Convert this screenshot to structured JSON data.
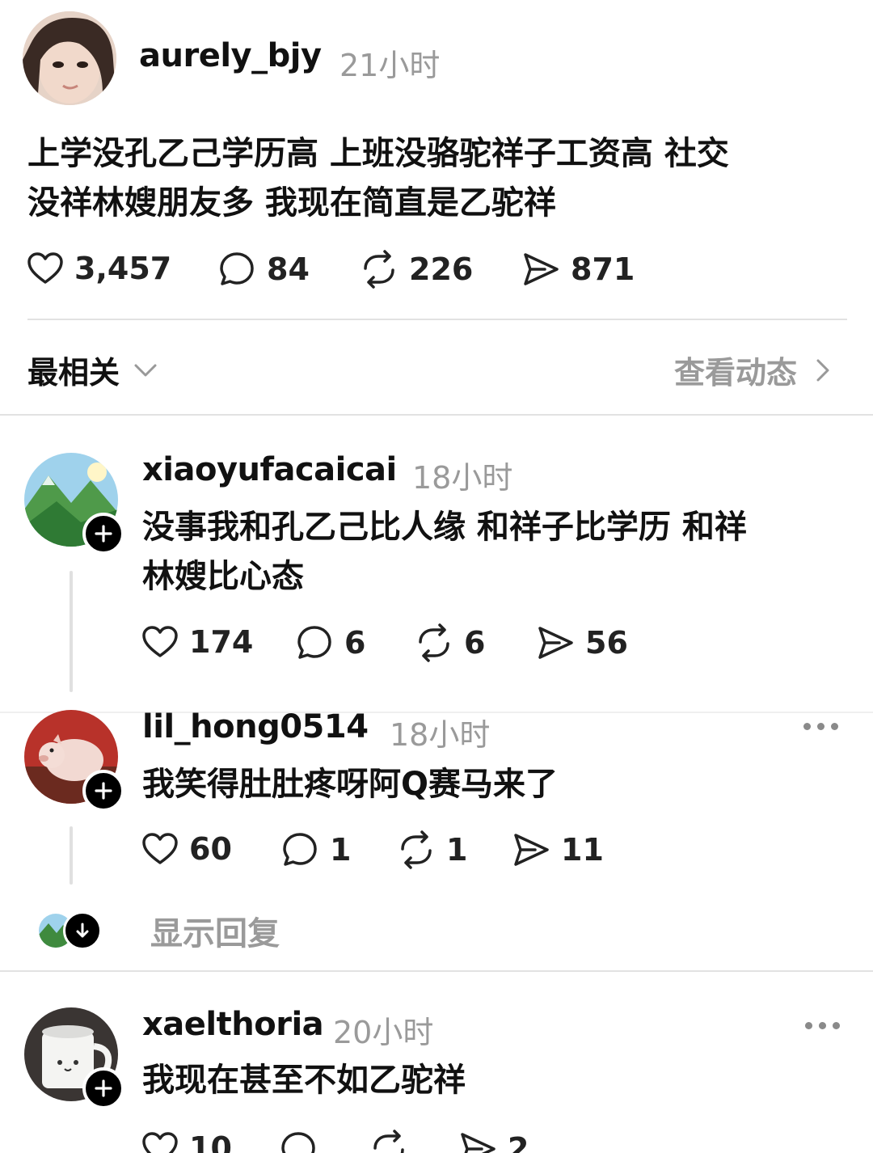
{
  "post": {
    "username": "aurely_bjy",
    "time": "21小时",
    "text_line1": "上学没孔乙己学历高 上班没骆驼祥子工资高 社交",
    "text_line2": "没祥林嫂朋友多 我现在简直是乙驼祥",
    "likes": "3,457",
    "comments": "84",
    "reposts": "226",
    "shares": "871"
  },
  "sort_bar": {
    "label": "最相关",
    "view_activity": "查看动态"
  },
  "replies": [
    {
      "username": "xiaoyufacaicai",
      "time": "18小时",
      "text_line1": "没事我和孔乙己比人缘 和祥子比学历 和祥",
      "text_line2": "林嫂比心态",
      "likes": "174",
      "comments": "6",
      "reposts": "6",
      "shares": "56"
    },
    {
      "username": "lil_hong0514",
      "time": "18小时",
      "text_line1": "我笑得肚肚疼呀阿Q赛马来了",
      "likes": "60",
      "comments": "1",
      "reposts": "1",
      "shares": "11"
    },
    {
      "username": "xaelthoria",
      "time": "20小时",
      "text_line1": "我现在甚至不如乙驼祥",
      "likes": "10",
      "comments": "",
      "reposts": "",
      "shares": "2"
    }
  ],
  "show_replies": "显示回复",
  "icons": {
    "like": "heart-icon",
    "comment": "comment-icon",
    "repost": "repost-icon",
    "share": "send-icon",
    "follow": "plus-icon",
    "more": "more-icon",
    "expand": "arrow-down-icon",
    "sort": "chevron-down-icon",
    "view": "chevron-right-icon"
  }
}
